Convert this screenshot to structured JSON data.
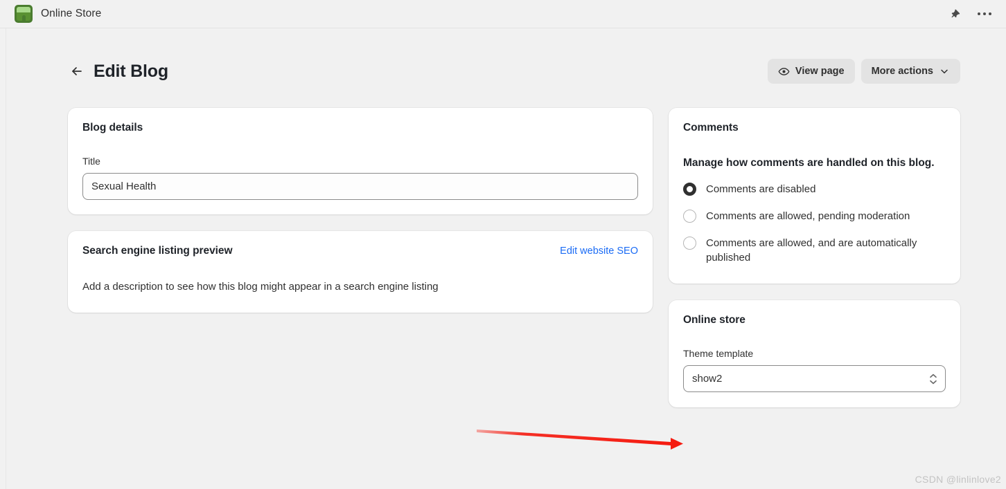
{
  "topbar": {
    "store_name": "Online Store",
    "logo_icon": "storefront-icon",
    "pin_icon": "pin-icon",
    "overflow_icon": "more-horizontal-icon"
  },
  "header": {
    "back_icon": "arrow-left-icon",
    "title": "Edit Blog",
    "view_page_label": "View page",
    "view_page_icon": "eye-icon",
    "more_actions_label": "More actions",
    "more_actions_icon": "chevron-down-icon"
  },
  "blog_details": {
    "title": "Blog details",
    "field_label": "Title",
    "title_value": "Sexual Health",
    "title_placeholder": "Blog title"
  },
  "seo": {
    "title": "Search engine listing preview",
    "edit_link": "Edit website SEO",
    "description": "Add a description to see how this blog might appear in a search engine listing"
  },
  "comments": {
    "title": "Comments",
    "lead": "Manage how comments are handled on this blog.",
    "options": [
      {
        "label": "Comments are disabled",
        "selected": true
      },
      {
        "label": "Comments are allowed, pending moderation",
        "selected": false
      },
      {
        "label": "Comments are allowed, and are automatically published",
        "selected": false
      }
    ]
  },
  "online_store": {
    "title": "Online store",
    "field_label": "Theme template",
    "template_value": "show2",
    "stepper_icon": "chevron-up-down-icon"
  },
  "annotation": {
    "arrow_color": "#f51a0f",
    "arrow_icon": "red-arrow-pointing-right"
  },
  "watermark": {
    "text": "CSDN @linlinlove2"
  },
  "colors": {
    "page_background": "#f1f1f1",
    "card_background": "#ffffff",
    "text_primary": "#303030",
    "link": "#1a6bf5",
    "button_background": "#e3e3e3",
    "logo_green_light": "#a8d98a",
    "logo_green_dark": "#4a7c2f"
  }
}
